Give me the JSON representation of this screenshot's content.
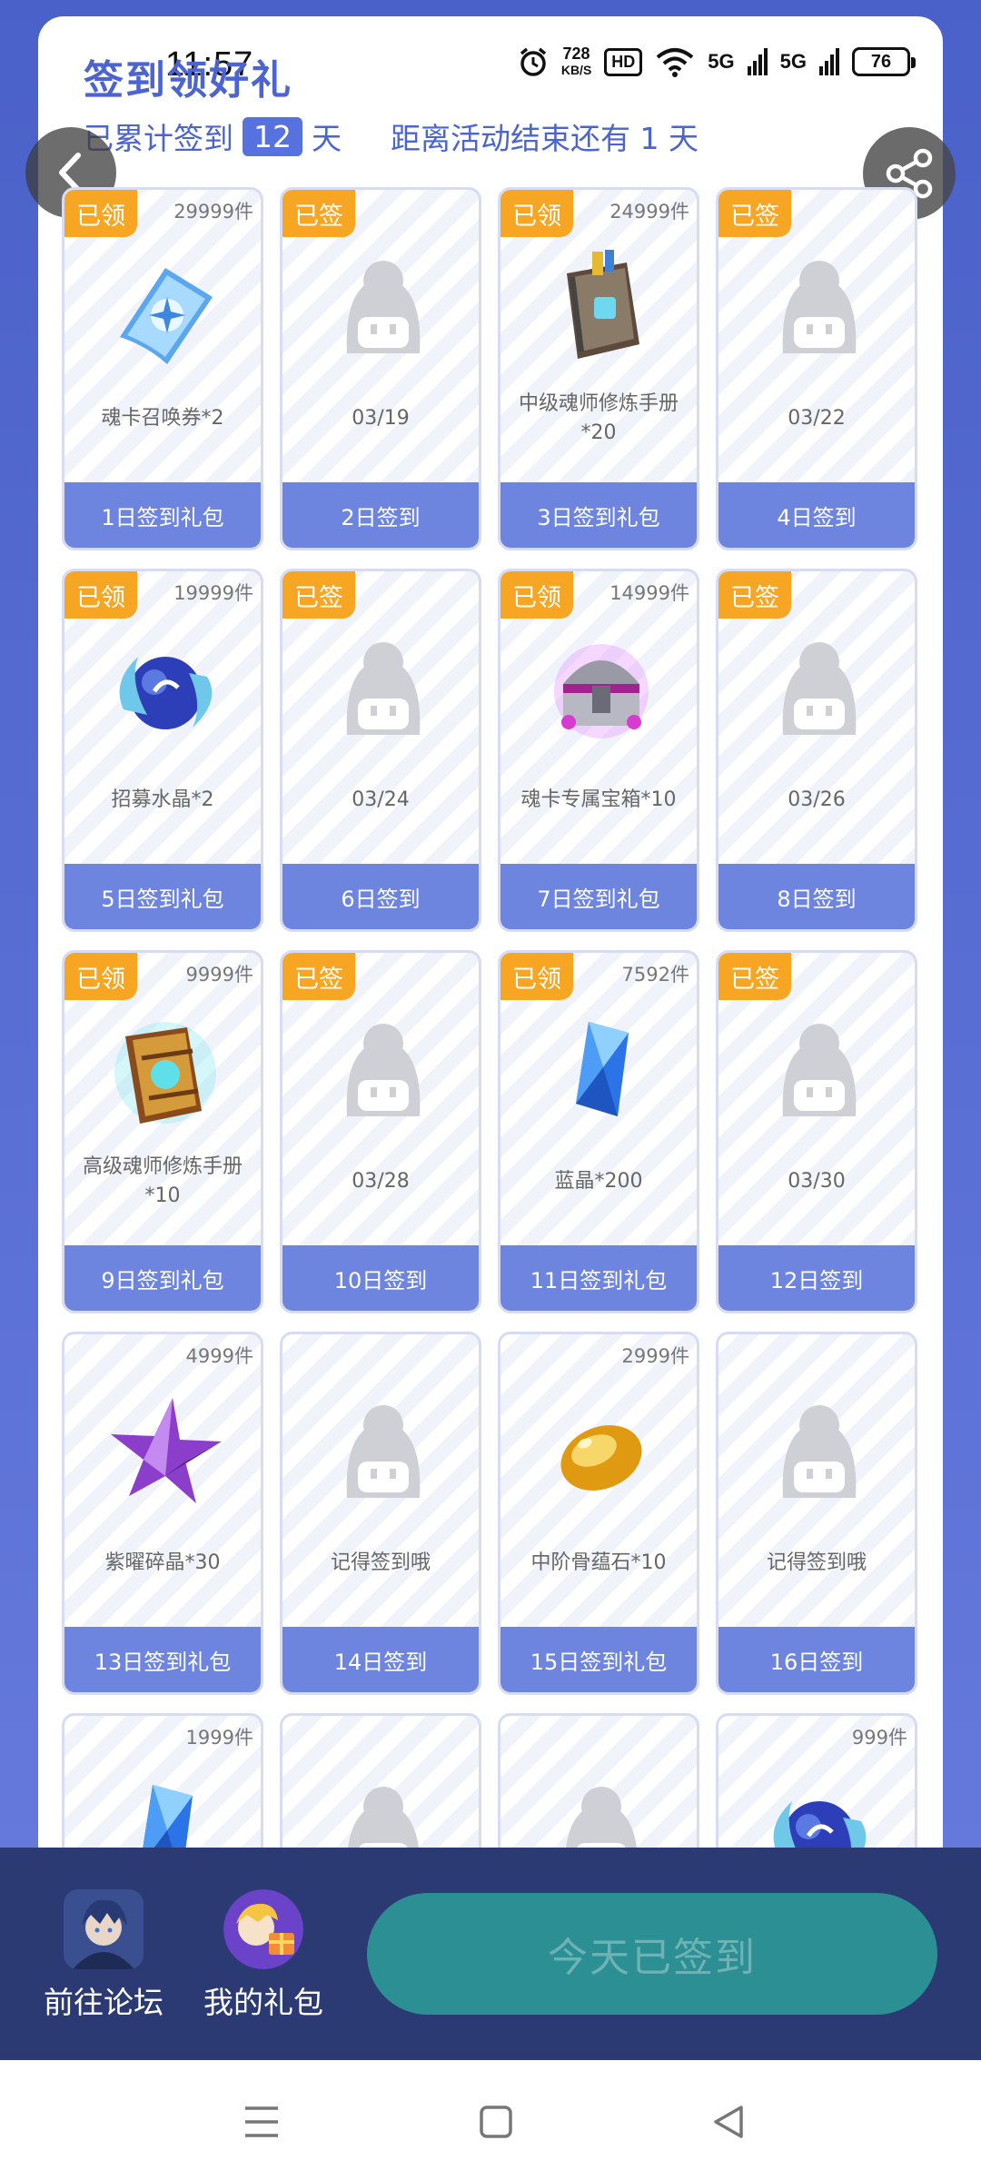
{
  "status_bar": {
    "time": "11:57",
    "net_speed_value": "728",
    "net_speed_unit": "KB/S",
    "hd_label": "HD",
    "signal_1": "5G",
    "signal_2": "5G",
    "battery": "76"
  },
  "header": {
    "title": "签到领好礼",
    "accum_prefix": "已累计签到",
    "accum_days": "12",
    "accum_suffix": "天",
    "end_text": "距离活动结束还有 1 天"
  },
  "cards": [
    {
      "tag": "已领",
      "qty": "29999件",
      "text": "魂卡召唤券*2",
      "footer": "1日签到礼包",
      "icon": "ticket-icon"
    },
    {
      "tag": "已签",
      "qty": "",
      "text": "03/19",
      "footer": "2日签到",
      "icon": "placeholder-icon"
    },
    {
      "tag": "已领",
      "qty": "24999件",
      "text": "中级魂师修炼手册*20",
      "footer": "3日签到礼包",
      "icon": "book-icon"
    },
    {
      "tag": "已签",
      "qty": "",
      "text": "03/22",
      "footer": "4日签到",
      "icon": "placeholder-icon"
    },
    {
      "tag": "已领",
      "qty": "19999件",
      "text": "招募水晶*2",
      "footer": "5日签到礼包",
      "icon": "orb-icon"
    },
    {
      "tag": "已签",
      "qty": "",
      "text": "03/24",
      "footer": "6日签到",
      "icon": "placeholder-icon"
    },
    {
      "tag": "已领",
      "qty": "14999件",
      "text": "魂卡专属宝箱*10",
      "footer": "7日签到礼包",
      "icon": "chest-icon"
    },
    {
      "tag": "已签",
      "qty": "",
      "text": "03/26",
      "footer": "8日签到",
      "icon": "placeholder-icon"
    },
    {
      "tag": "已领",
      "qty": "9999件",
      "text": "高级魂师修炼手册*10",
      "footer": "9日签到礼包",
      "icon": "gold-book-icon"
    },
    {
      "tag": "已签",
      "qty": "",
      "text": "03/28",
      "footer": "10日签到",
      "icon": "placeholder-icon"
    },
    {
      "tag": "已领",
      "qty": "7592件",
      "text": "蓝晶*200",
      "footer": "11日签到礼包",
      "icon": "crystal-icon"
    },
    {
      "tag": "已签",
      "qty": "",
      "text": "03/30",
      "footer": "12日签到",
      "icon": "placeholder-icon"
    },
    {
      "tag": "",
      "qty": "4999件",
      "text": "紫曜碎晶*30",
      "footer": "13日签到礼包",
      "icon": "star-icon"
    },
    {
      "tag": "",
      "qty": "",
      "text": "记得签到哦",
      "footer": "14日签到",
      "icon": "placeholder-icon"
    },
    {
      "tag": "",
      "qty": "2999件",
      "text": "中阶骨蕴石*10",
      "footer": "15日签到礼包",
      "icon": "amber-stone-icon"
    },
    {
      "tag": "",
      "qty": "",
      "text": "记得签到哦",
      "footer": "16日签到",
      "icon": "placeholder-icon"
    },
    {
      "tag": "",
      "qty": "1999件",
      "text": "",
      "footer": "",
      "icon": "crystal-icon"
    },
    {
      "tag": "",
      "qty": "",
      "text": "",
      "footer": "",
      "icon": "placeholder-icon"
    },
    {
      "tag": "",
      "qty": "",
      "text": "",
      "footer": "",
      "icon": "placeholder-icon"
    },
    {
      "tag": "",
      "qty": "999件",
      "text": "",
      "footer": "",
      "icon": "orb-icon"
    }
  ],
  "bottom": {
    "forum_label": "前往论坛",
    "gifts_label": "我的礼包",
    "signed_label": "今天已签到"
  },
  "colors": {
    "accent": "#4b64cf",
    "tag": "#f6a623",
    "footer": "#6e85e0",
    "bottom_bar": "#2b3a72",
    "signed_button": "#2c8f93"
  }
}
